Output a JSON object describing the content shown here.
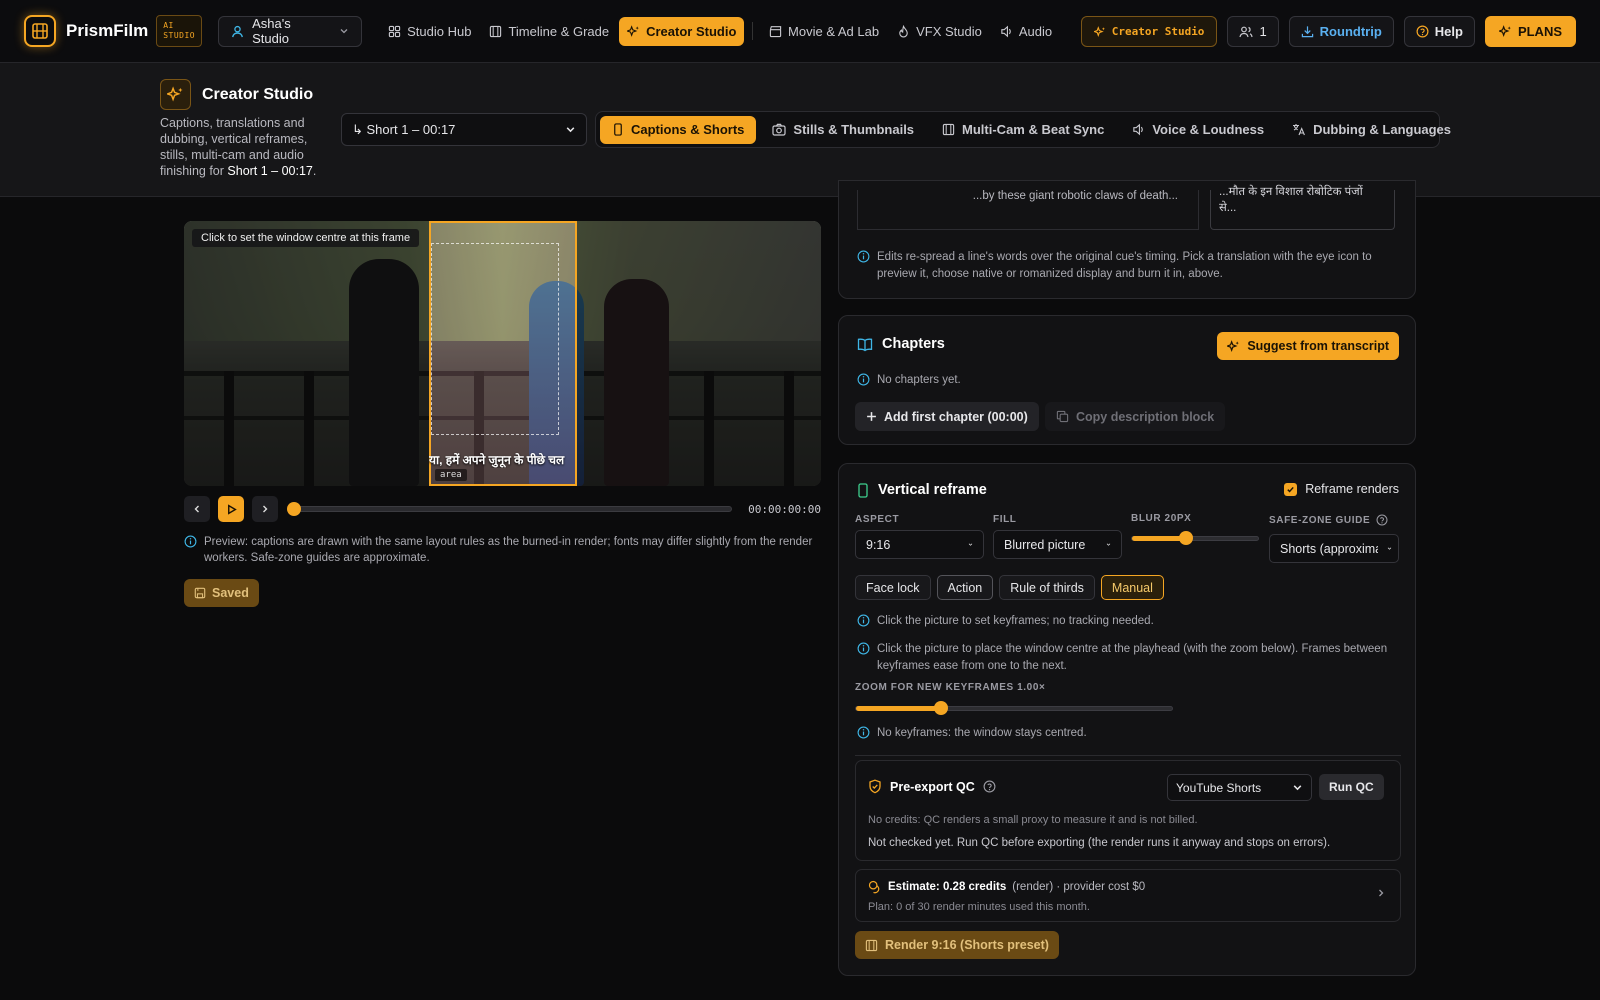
{
  "topbar": {
    "brand": "PrismFilm",
    "ai_badge_line1": "AI",
    "ai_badge_line2": "STUDIO",
    "studio": "Asha's Studio",
    "nav": [
      {
        "label": "Studio Hub",
        "icon": "grid-icon"
      },
      {
        "label": "Timeline & Grade",
        "icon": "film-icon"
      },
      {
        "label": "Creator Studio",
        "icon": "sparkles-icon",
        "active": true
      },
      {
        "label": "Movie & Ad Lab",
        "icon": "clapper-icon"
      },
      {
        "label": "VFX Studio",
        "icon": "flame-icon"
      },
      {
        "label": "Audio",
        "icon": "speaker-icon"
      }
    ],
    "creator_studio_btn": "Creator Studio",
    "collaborators": "1",
    "roundtrip": "Roundtrip",
    "help": "Help",
    "plans": "PLANS"
  },
  "subheader": {
    "title": "Creator Studio",
    "desc_prefix": "Captions, translations and dubbing, vertical reframes, stills, multi-cam and audio finishing for ",
    "desc_short": "Short 1 – 00:17",
    "desc_suffix": ".",
    "short_select": "↳ Short 1 – 00:17",
    "tabs": [
      {
        "label": "Captions & Shorts",
        "icon": "phone-icon",
        "active": true
      },
      {
        "label": "Stills & Thumbnails",
        "icon": "camera-icon"
      },
      {
        "label": "Multi-Cam & Beat Sync",
        "icon": "film-icon"
      },
      {
        "label": "Voice & Loudness",
        "icon": "speaker-icon"
      },
      {
        "label": "Dubbing & Languages",
        "icon": "translate-icon"
      }
    ]
  },
  "preview": {
    "hint": "Click to set the window centre at this frame",
    "caption_text": "या, हमें अपने जुनून के पीछे चल",
    "area_label": "area",
    "timecode": "00:00:00:00",
    "note": "Preview: captions are drawn with the same layout rules as the burned-in render; fonts may differ slightly from the render workers. Safe-zone guides are approximate.",
    "saved_label": "Saved",
    "playhead_fraction": 0
  },
  "captions_panel": {
    "source_line": "...by these giant robotic claws of death...",
    "translation_line1": "...मौत के इन विशाल रोबोटिक पंजों",
    "translation_line2": "से...",
    "note": "Edits re-spread a line's words over the original cue's timing. Pick a translation with the eye icon to preview it, choose native or romanized display and burn it in, above."
  },
  "chapters": {
    "title": "Chapters",
    "suggest": "Suggest from transcript",
    "empty": "No chapters yet.",
    "add_first": "Add first chapter (00:00)",
    "copy_desc": "Copy description block"
  },
  "reframe": {
    "title": "Vertical reframe",
    "reframe_renders_label": "Reframe renders",
    "reframe_renders_checked": true,
    "aspect_label": "ASPECT",
    "aspect_value": "9:16",
    "fill_label": "FILL",
    "fill_value": "Blurred picture",
    "blur_label": "BLUR 20PX",
    "blur_fraction": 0.43,
    "safezone_label": "SAFE-ZONE GUIDE",
    "safezone_value": "Shorts (approximate)",
    "modes": [
      "Face lock",
      "Action",
      "Rule of thirds",
      "Manual"
    ],
    "active_mode": "Manual",
    "info1": "Click the picture to set keyframes; no tracking needed.",
    "info2": "Click the picture to place the window centre at the playhead (with the zoom below). Frames between keyframes ease from one to the next.",
    "zoom_label": "ZOOM FOR NEW KEYFRAMES 1.00×",
    "zoom_fraction": 0.27,
    "info3": "No keyframes: the window stays centred."
  },
  "qc": {
    "title": "Pre-export QC",
    "preset": "YouTube Shorts",
    "run": "Run QC",
    "credits_note": "No credits: QC renders a small proxy to measure it and is not billed.",
    "status": "Not checked yet. Run QC before exporting (the render runs it anyway and stops on errors)."
  },
  "estimate": {
    "label": "Estimate: 0.28 credits",
    "detail": "(render) · provider cost $0",
    "plan": "Plan: 0 of 30 render minutes used this month."
  },
  "render_button": "Render 9:16 (Shorts preset)",
  "colors": {
    "accent": "#f5a623",
    "link_blue": "#5ab0f0",
    "info_cyan": "#3fb6e6"
  }
}
